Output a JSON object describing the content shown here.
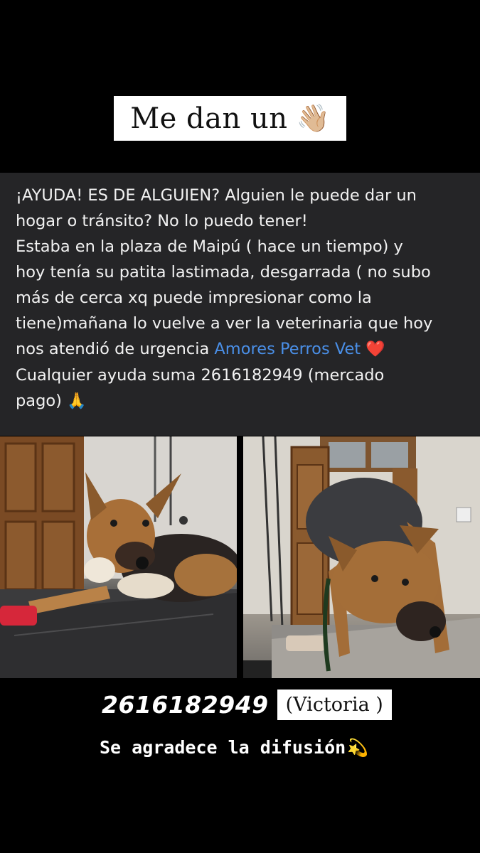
{
  "header": {
    "title": "Me dan un",
    "title_emoji": "👋🏼",
    "title_emoji_icon": "waving-hand-icon"
  },
  "post": {
    "lines": [
      "¡AYUDA! ES DE ALGUIEN? Alguien le puede dar un",
      "hogar o tránsito? No lo puedo tener!",
      "Estaba en la plaza de Maipú ( hace un tiempo) y",
      "hoy tenía su patita lastimada, desgarrada ( no subo",
      "más de cerca xq puede impresionar como la",
      "tiene)mañana lo vuelve a ver la veterinaria que hoy"
    ],
    "line7_prefix": "nos atendió de urgencia ",
    "vet_name": "Amores Perros Vet",
    "heart": "❤️",
    "heart_icon": "red-heart-icon",
    "line8": "Cualquier ayuda suma 2616182949 (mercado",
    "line9": "pago) ",
    "pray": "🙏",
    "pray_icon": "folded-hands-icon",
    "link_color": "#4a8fe7"
  },
  "photos": {
    "left_icon": "dog-lying-on-vet-table-photo",
    "right_icon": "dog-standing-on-vet-table-photo"
  },
  "contact": {
    "phone": "2616182949",
    "name": "(Victoria )"
  },
  "footer": {
    "thanks": "Se agradece la difusión",
    "sparkle": "💫",
    "sparkle_icon": "dizzy-star-icon"
  }
}
